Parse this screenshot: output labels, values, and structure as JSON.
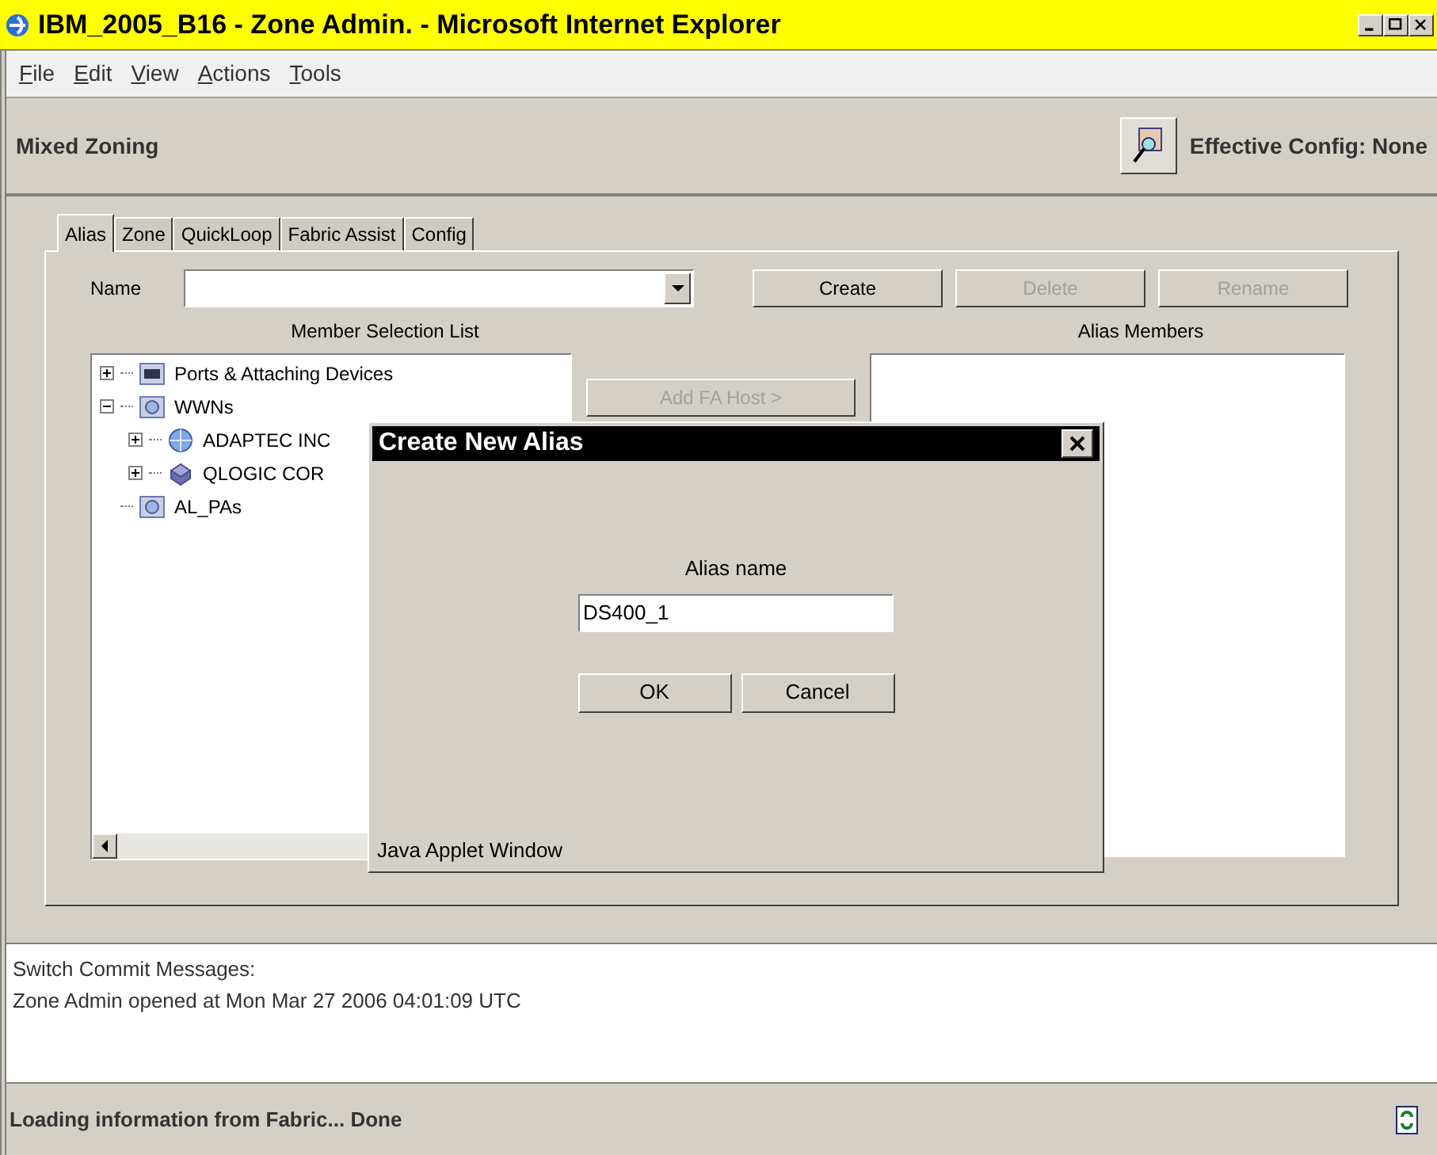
{
  "window": {
    "title": "IBM_2005_B16 - Zone Admin. - Microsoft Internet Explorer"
  },
  "menu": [
    "File",
    "Edit",
    "View",
    "Actions",
    "Tools"
  ],
  "header": {
    "title": "Mixed Zoning",
    "effective_config": "Effective Config: None"
  },
  "tabs": [
    {
      "label": "Alias",
      "selected": true
    },
    {
      "label": "Zone",
      "selected": false
    },
    {
      "label": "QuickLoop",
      "selected": false
    },
    {
      "label": "Fabric Assist",
      "selected": false
    },
    {
      "label": "Config",
      "selected": false
    }
  ],
  "name_label": "Name",
  "buttons": [
    {
      "label": "Create",
      "disabled": false
    },
    {
      "label": "Delete",
      "disabled": true
    },
    {
      "label": "Rename",
      "disabled": true
    }
  ],
  "member_list_title": "Member Selection List",
  "alias_members_title": "Alias Members",
  "add_button": {
    "label": "Add FA Host >",
    "disabled": true
  },
  "tree": [
    {
      "label": "Ports & Attaching Devices",
      "kind": "ports",
      "expanded": false
    },
    {
      "label": "WWNs",
      "kind": "folder",
      "expanded": true,
      "children": [
        {
          "label": "ADAPTEC INC",
          "kind": "globe",
          "expanded": false
        },
        {
          "label": "QLOGIC COR",
          "kind": "device",
          "expanded": false
        }
      ]
    },
    {
      "label": "AL_PAs",
      "kind": "folder"
    }
  ],
  "dialog": {
    "title": "Create New Alias",
    "field_label": "Alias name",
    "value": "DS400_1",
    "buttons": [
      "OK",
      "Cancel"
    ],
    "footer": "Java Applet Window"
  },
  "messages": [
    "Switch Commit Messages:",
    "Zone Admin opened at Mon Mar 27 2006 04:01:09 UTC"
  ],
  "status_bar": "Loading information from Fabric... Done"
}
